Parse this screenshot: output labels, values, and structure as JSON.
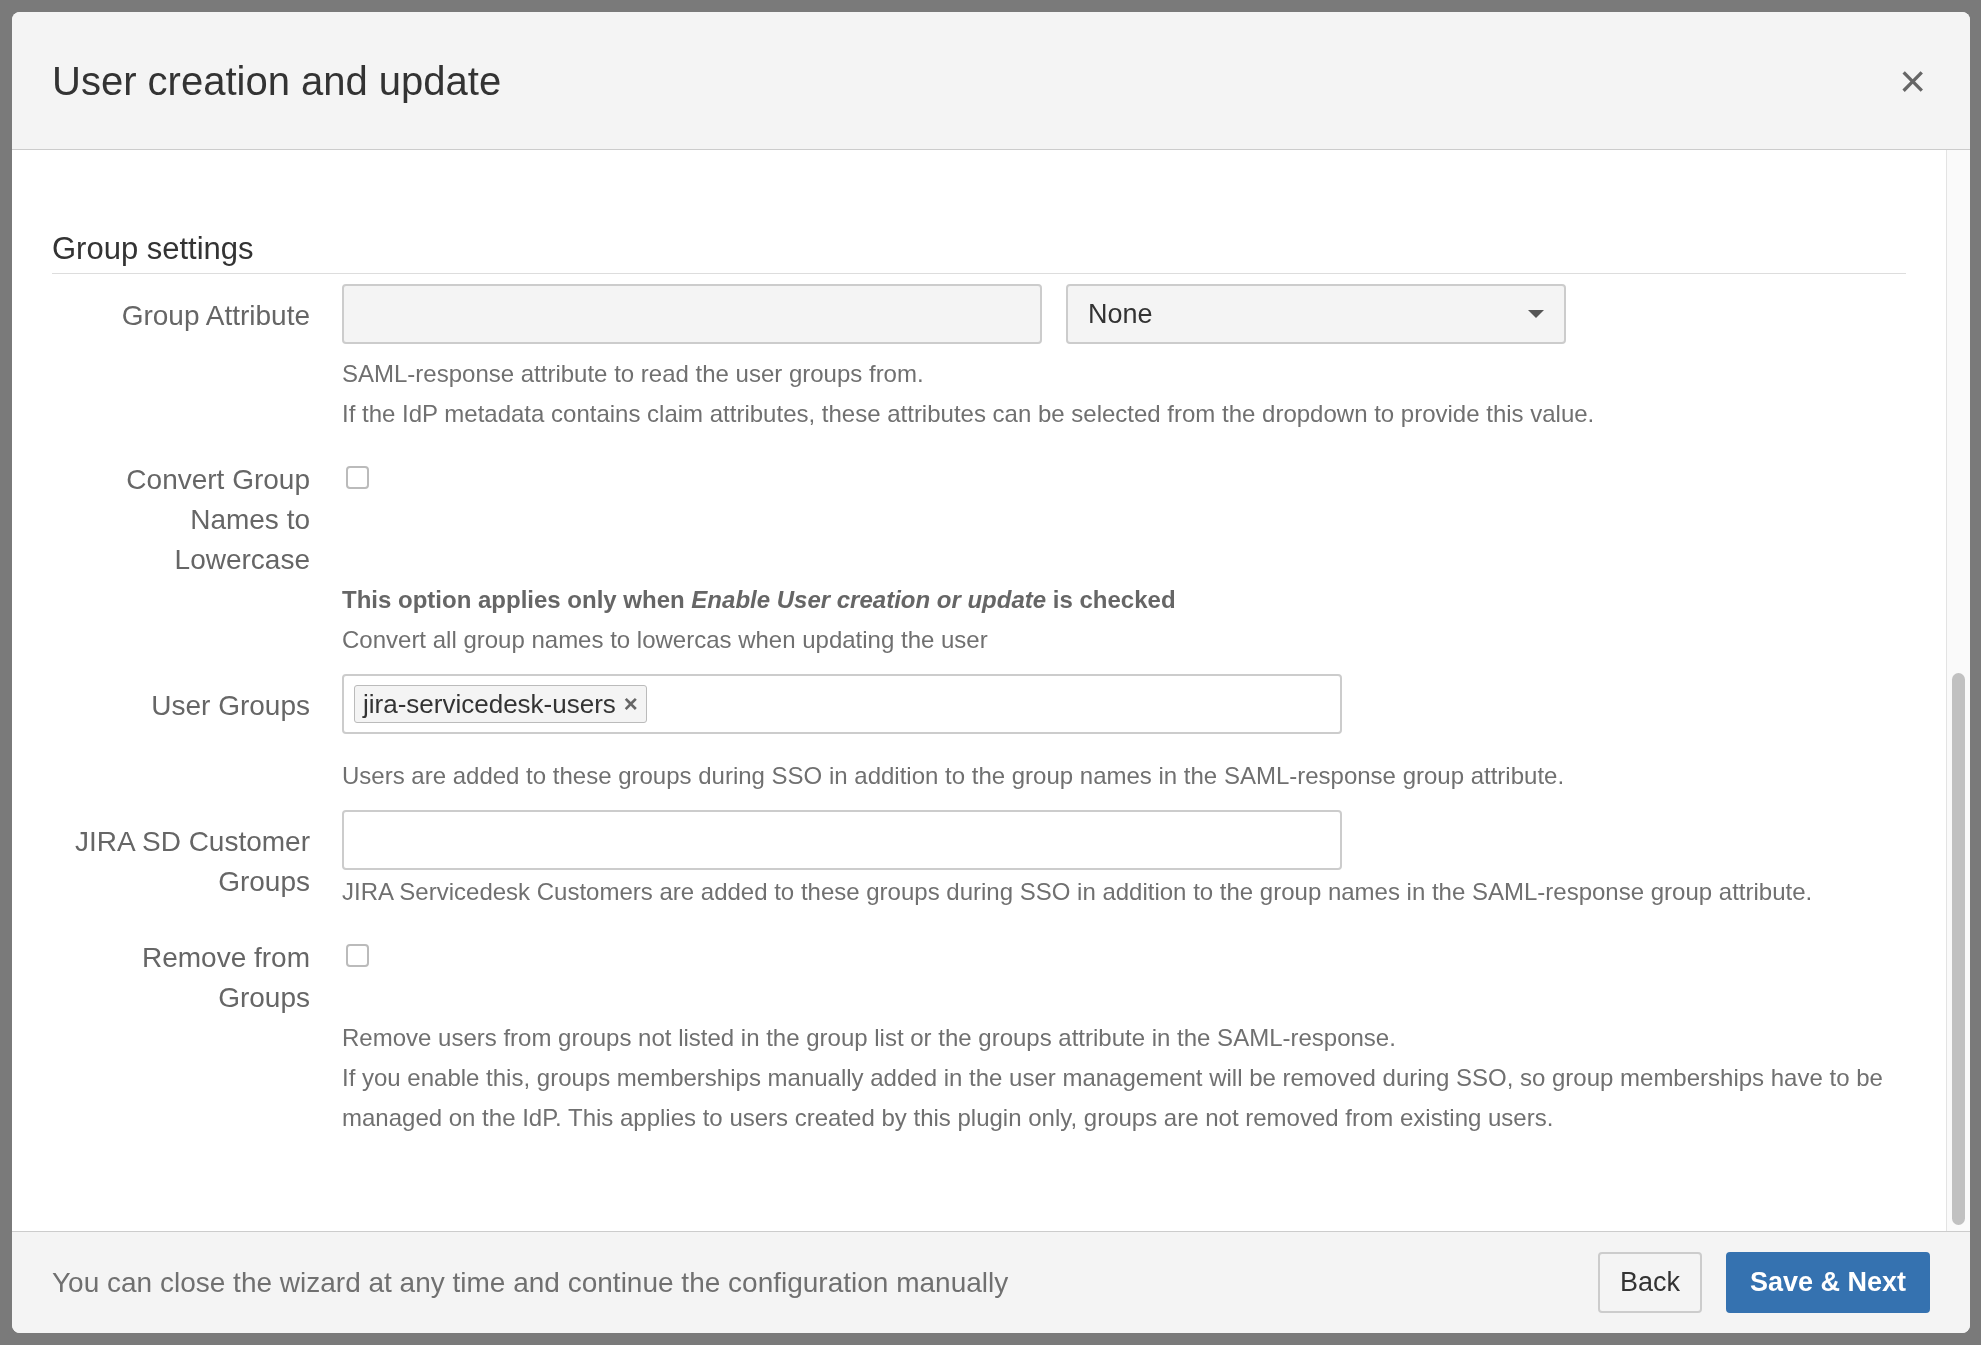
{
  "dialog": {
    "title": "User creation and update",
    "close": "×"
  },
  "section": {
    "title": "Group settings"
  },
  "fields": [
    {
      "kind": "attribute",
      "label": "Group Attribute",
      "select": "None",
      "help": [
        "SAML-response attribute to read the user groups from.",
        "If the IdP metadata contains claim attributes, these attributes can be selected from the dropdown to provide this value."
      ]
    },
    {
      "kind": "checkbox",
      "label": "Convert Group Names to Lowercase",
      "checked": false,
      "help": [
        "**This option applies only when *Enable User creation or update* is checked**",
        "Convert all group names to lowercas when updating the user"
      ]
    },
    {
      "kind": "tags",
      "label": "User Groups",
      "tags": [
        {
          "text": "jira-servicedesk-users",
          "remove": "×"
        }
      ],
      "help": [
        "Users are added to these groups during SSO in addition to the group names in the SAML-response group attribute."
      ]
    },
    {
      "kind": "tags",
      "label": "JIRA SD Customer Groups",
      "help": [
        "JIRA Servicedesk Customers are added to these groups during SSO in addition to the group names in the SAML-response group attribute."
      ]
    },
    {
      "kind": "checkbox",
      "label": "Remove from Groups",
      "checked": false,
      "help": [
        "Remove users from groups not listed in the group list or the groups attribute in the SAML-response.",
        "If you enable this, groups memberships manually added in the user management will be removed during SSO, so group memberships have to be managed on the IdP. This applies to users created by this plugin only, groups are not removed from existing users."
      ]
    }
  ],
  "footer": {
    "note": "You can close the wizard at any time and continue the configuration manually",
    "buttons": [
      {
        "label": "Back",
        "kind": "secondary"
      },
      {
        "label": "Save & Next",
        "kind": "primary"
      }
    ]
  }
}
